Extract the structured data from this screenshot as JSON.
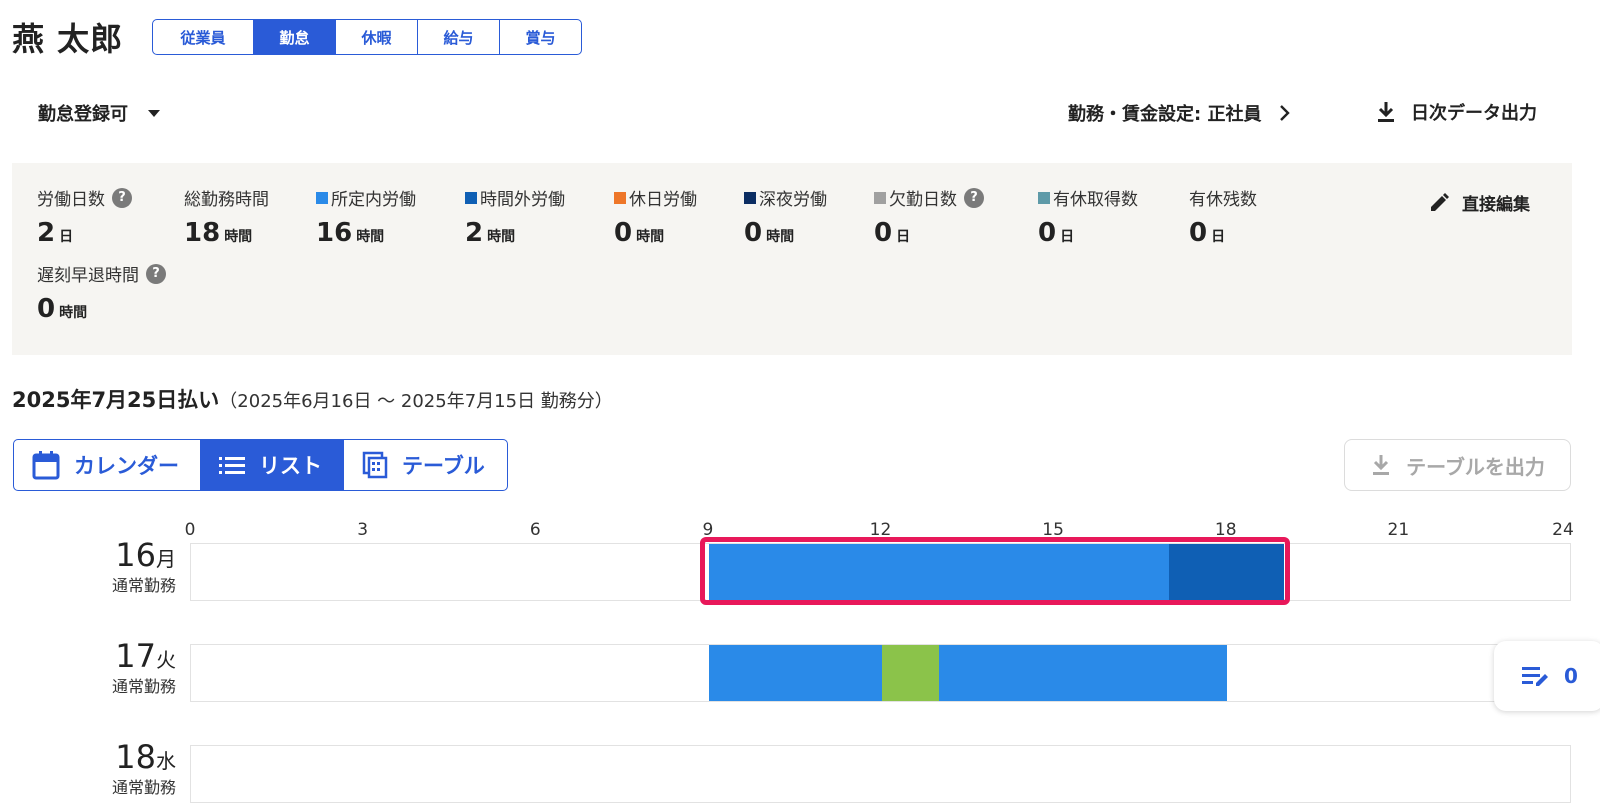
{
  "employee": {
    "name": "燕 太郎"
  },
  "tabs": [
    {
      "label": "従業員",
      "active": false
    },
    {
      "label": "勤怠",
      "active": true
    },
    {
      "label": "休暇",
      "active": false
    },
    {
      "label": "給与",
      "active": false
    },
    {
      "label": "賞与",
      "active": false
    }
  ],
  "toolbar": {
    "status_label": "勤怠登録可",
    "wage_setting_label": "勤務・賃金設定: 正社員",
    "export_daily_label": "日次データ出力"
  },
  "summary": {
    "direct_edit_label": "直接編集",
    "stats": [
      {
        "label": "労働日数",
        "value": "2",
        "unit": "日",
        "help": true
      },
      {
        "label": "総勤務時間",
        "value": "18",
        "unit": "時間"
      },
      {
        "label": "所定内労働",
        "value": "16",
        "unit": "時間",
        "color": "#2a8ae8"
      },
      {
        "label": "時間外労働",
        "value": "2",
        "unit": "時間",
        "color": "#0f5fb4"
      },
      {
        "label": "休日労働",
        "value": "0",
        "unit": "時間",
        "color": "#ee7628"
      },
      {
        "label": "深夜労働",
        "value": "0",
        "unit": "時間",
        "color": "#0b2d62"
      },
      {
        "label": "欠勤日数",
        "value": "0",
        "unit": "日",
        "color": "#a0a0a0",
        "help": true
      },
      {
        "label": "有休取得数",
        "value": "0",
        "unit": "日",
        "color": "#5e9aa8"
      },
      {
        "label": "有休残数",
        "value": "0",
        "unit": "日"
      },
      {
        "label": "遅刻早退時間",
        "value": "0",
        "unit": "時間",
        "help": true
      }
    ]
  },
  "period": {
    "pay_date": "2025年7月25日払い",
    "range": "（2025年6月16日 ～ 2025年7月15日 勤務分）"
  },
  "views": {
    "calendar_label": "カレンダー",
    "list_label": "リスト",
    "table_label": "テーブル",
    "active": "list",
    "export_table_label": "テーブルを出力"
  },
  "timeline": {
    "ticks": [
      "0",
      "3",
      "6",
      "9",
      "12",
      "15",
      "18",
      "21",
      "24"
    ],
    "colors": {
      "regular": "#2a8ae8",
      "overtime": "#0f5fb4",
      "break": "#8bc34a"
    },
    "days": [
      {
        "date": "16",
        "weekday": "月",
        "type": "通常勤務",
        "highlighted": true,
        "segments": [
          {
            "kind": "regular",
            "start": 9,
            "end": 17
          },
          {
            "kind": "overtime",
            "start": 17,
            "end": 19
          }
        ]
      },
      {
        "date": "17",
        "weekday": "火",
        "type": "通常勤務",
        "segments": [
          {
            "kind": "regular",
            "start": 9,
            "end": 12
          },
          {
            "kind": "break",
            "start": 12,
            "end": 13
          },
          {
            "kind": "regular",
            "start": 13,
            "end": 18
          }
        ]
      },
      {
        "date": "18",
        "weekday": "水",
        "type": "通常勤務",
        "segments": []
      }
    ]
  },
  "notes": {
    "count": "0"
  }
}
